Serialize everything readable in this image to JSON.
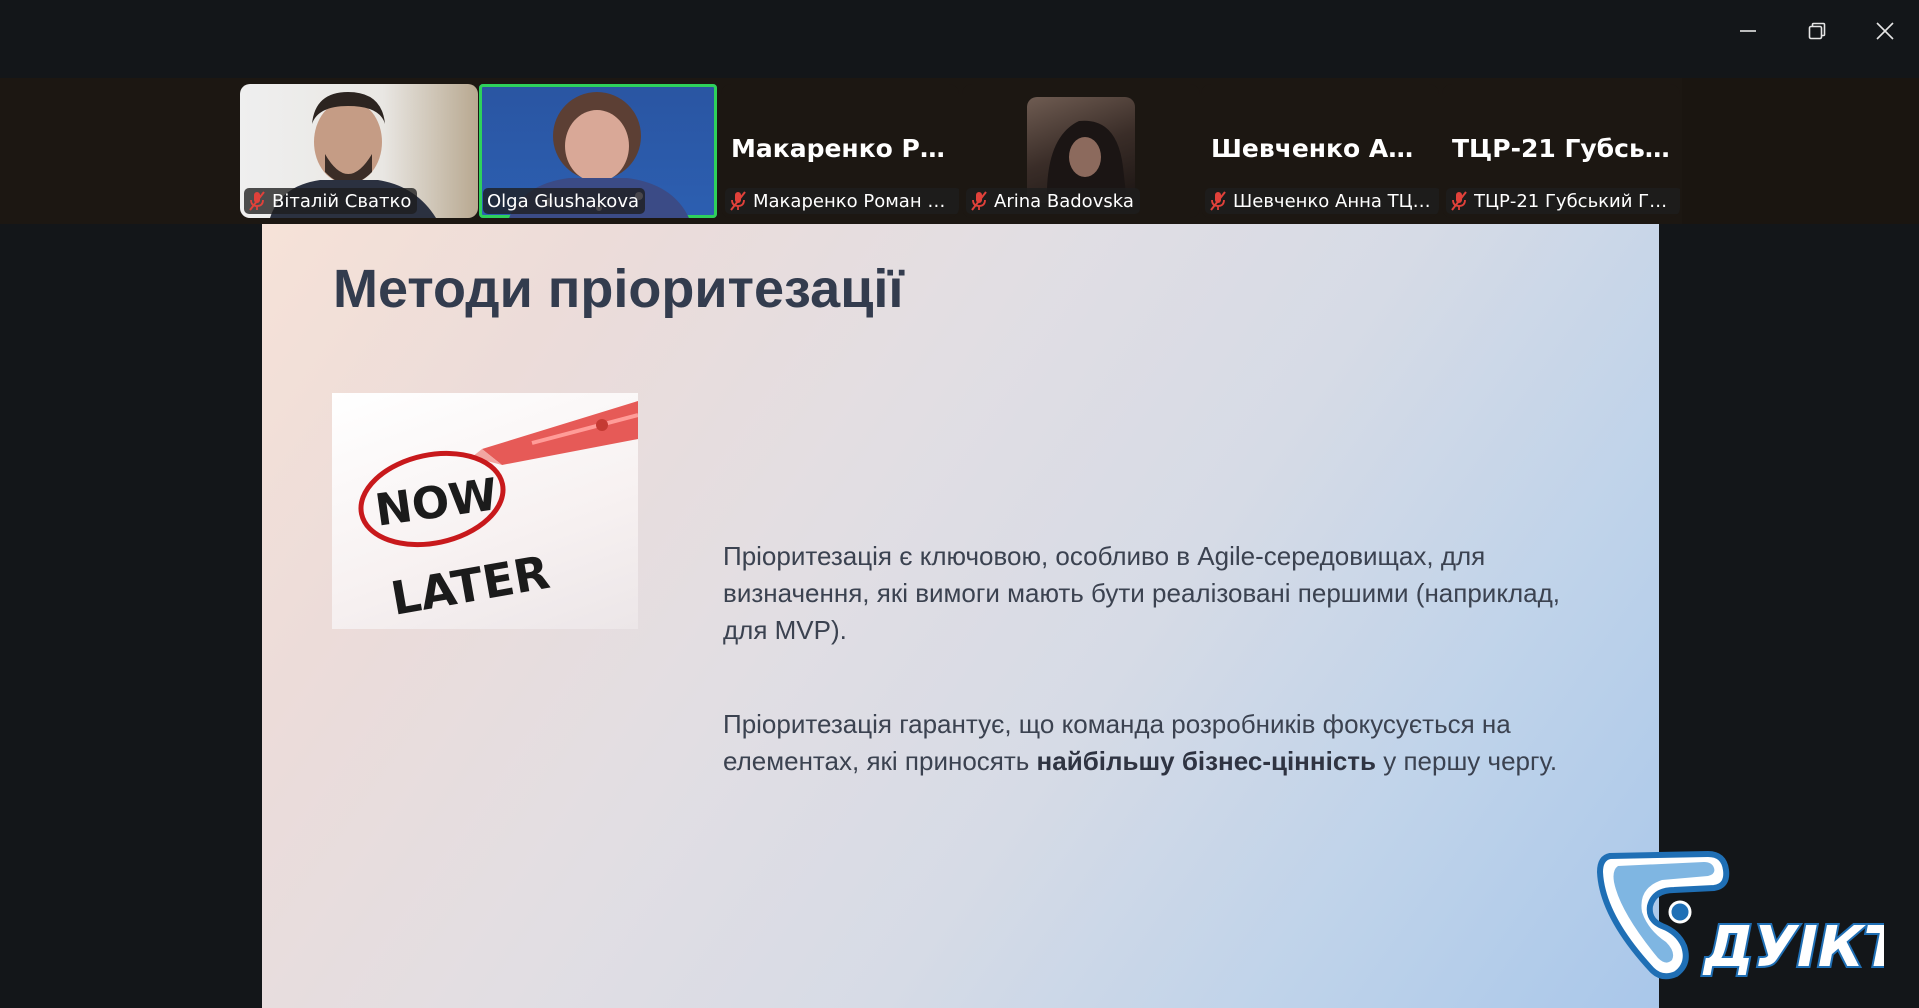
{
  "window_controls": {
    "minimize_icon": "minimize-icon",
    "restore_icon": "restore-icon",
    "close_icon": "close-icon"
  },
  "participants": [
    {
      "name": "Віталій Сватко",
      "video": true,
      "muted": true,
      "active": false
    },
    {
      "name": "Olga Glushakova",
      "video": true,
      "muted": false,
      "active": true
    },
    {
      "name": "Макаренко Роман Ан...",
      "display_name": "Макаренко  Ро...",
      "video": false,
      "muted": true,
      "active": false
    },
    {
      "name": "Arina Badovska",
      "video": true,
      "muted": true,
      "active": false
    },
    {
      "name": "Шевченко Анна ТЦР-...",
      "display_name": "Шевченко  Анн...",
      "video": false,
      "muted": true,
      "active": false
    },
    {
      "name": "ТЦР-21 Губський Гео...",
      "display_name": "ТЦР-21  Губськ...",
      "video": false,
      "muted": true,
      "active": false
    }
  ],
  "slide": {
    "title": "Методи пріоритезації",
    "image_text": {
      "now": "NOW",
      "later": "LATER"
    },
    "paragraph1": "Пріоритезація є ключовою, особливо в Agile-середовищах, для визначення, які вимоги мають бути реалізовані першими (наприклад, для MVP).",
    "paragraph2_before": "Пріоритезація гарантує, що команда розробників фокусується на елементах, які приносять ",
    "paragraph2_bold": "найбільшу бізнес-цінність",
    "paragraph2_after": " у першу чергу."
  },
  "logo": {
    "text": "ДУІКТ"
  },
  "colors": {
    "active_speaker": "#2ed15b",
    "muted_icon": "#e0413a",
    "slide_title": "#333c4e",
    "logo_blue": "#1f6fb5"
  }
}
